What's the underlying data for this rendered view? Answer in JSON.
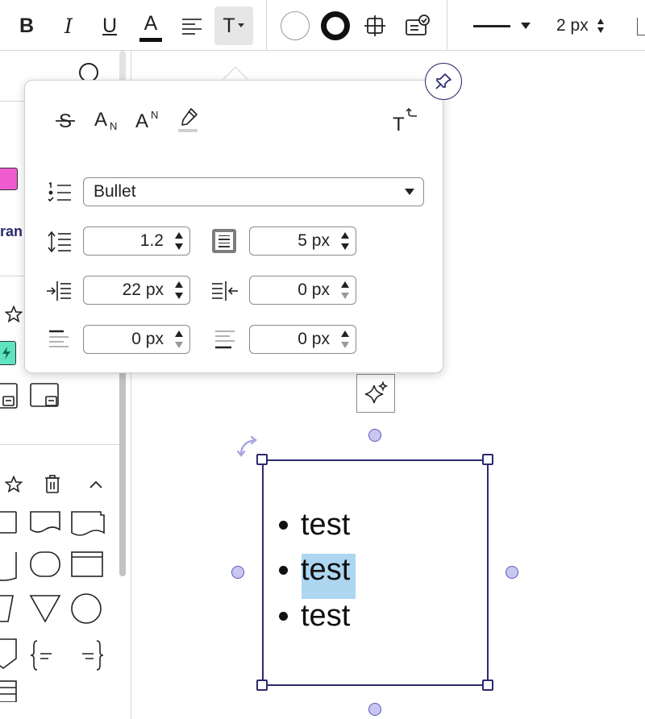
{
  "toolbar": {
    "bold": "B",
    "italic": "I",
    "underline": "U",
    "font_color": "A",
    "text_tool": "T",
    "line_width": "2 px"
  },
  "left_panel": {
    "partial_label": "ran"
  },
  "popover": {
    "list_type": {
      "selected": "Bullet"
    },
    "line_spacing": "1.2",
    "paragraph_spacing": "5 px",
    "indent_left": "22 px",
    "indent_right": "0 px",
    "space_before": "0 px",
    "space_after": "0 px"
  },
  "textbox": {
    "items": [
      "test",
      "test",
      "test"
    ],
    "selected_item_index": 1
  },
  "colors": {
    "accent": "#2c2a6e",
    "selection": "#add6f0",
    "pink_swatch": "#f05bd1",
    "green_swatch": "#5fe3c0"
  }
}
